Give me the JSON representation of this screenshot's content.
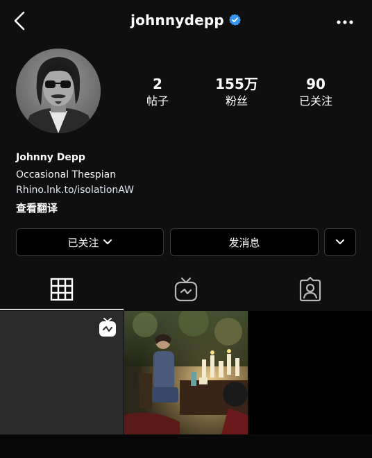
{
  "header": {
    "username": "johnnydepp",
    "verified": true,
    "back_icon": "chevron-left-icon",
    "more_icon": "more-horizontal-icon"
  },
  "profile": {
    "stats": [
      {
        "value": "2",
        "label": "帖子"
      },
      {
        "value": "155万",
        "label": "粉丝"
      },
      {
        "value": "90",
        "label": "已关注"
      }
    ],
    "name": "Johnny Depp",
    "bio": "Occasional Thespian",
    "link": "Rhino.lnk.to/isolationAW",
    "translate": "查看翻译"
  },
  "actions": {
    "following_label": "已关注",
    "message_label": "发消息"
  },
  "tabs": [
    {
      "name": "posts-grid",
      "icon": "grid-icon",
      "active": true
    },
    {
      "name": "igtv",
      "icon": "igtv-icon",
      "active": false
    },
    {
      "name": "tagged",
      "icon": "tagged-user-icon",
      "active": false
    }
  ],
  "colors": {
    "background": "#0f0f0f",
    "verified_badge": "#3897f0",
    "button_border": "#3a3a3a"
  }
}
